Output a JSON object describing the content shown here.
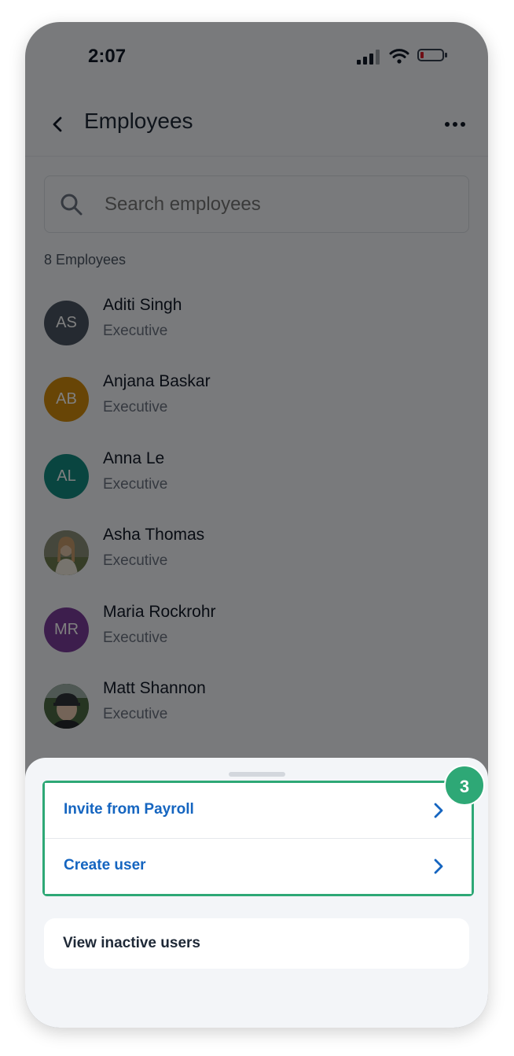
{
  "status_bar": {
    "time": "2:07"
  },
  "header": {
    "title": "Employees"
  },
  "search": {
    "placeholder": "Search employees"
  },
  "employee_count": "8 Employees",
  "employees": [
    {
      "name": "Aditi Singh",
      "role": "Executive",
      "initials": "AS",
      "avatar_color": "#4b5563"
    },
    {
      "name": "Anjana Baskar",
      "role": "Executive",
      "initials": "AB",
      "avatar_color": "#d08a0c"
    },
    {
      "name": "Anna Le",
      "role": "Executive",
      "initials": "AL",
      "avatar_color": "#138a80"
    },
    {
      "name": "Asha Thomas",
      "role": "Executive",
      "initials": "",
      "avatar_color": "#7a7d6c"
    },
    {
      "name": "Maria Rockrohr",
      "role": "Executive",
      "initials": "MR",
      "avatar_color": "#7b3d9a"
    },
    {
      "name": "Matt Shannon",
      "role": "Executive",
      "initials": "",
      "avatar_color": "#3f5a3d"
    }
  ],
  "sheet": {
    "items": [
      {
        "label": "Invite from Payroll"
      },
      {
        "label": "Create user"
      }
    ],
    "inactive_label": "View inactive users"
  },
  "step_badge": "3",
  "colors": {
    "accent_green": "#2ea876",
    "link_blue": "#1565c0"
  }
}
